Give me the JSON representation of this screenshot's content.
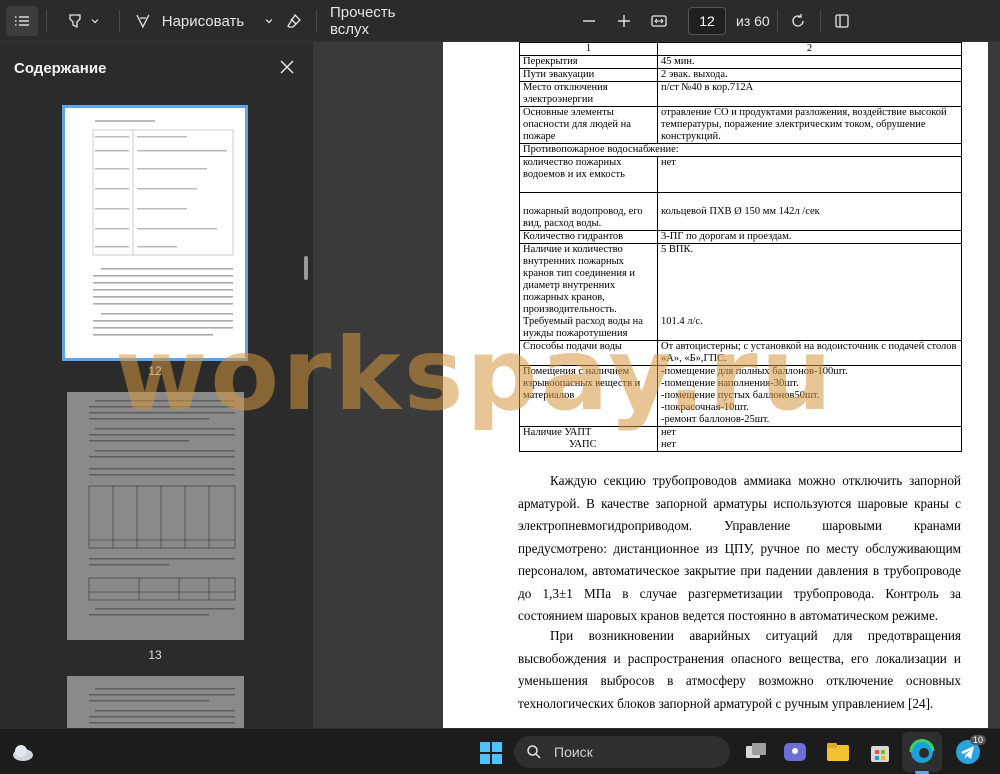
{
  "toolbar": {
    "draw_label": "Нарисовать",
    "read_aloud_label": "Прочесть вслух",
    "page_number": "12",
    "page_total": "из 60"
  },
  "sidebar": {
    "title": "Содержание",
    "thumbnails": [
      {
        "label": "12",
        "selected": true
      },
      {
        "label": "13",
        "selected": false
      }
    ]
  },
  "document": {
    "table": {
      "header": [
        "1",
        "2"
      ],
      "rows": [
        {
          "c1": "Перекрытия",
          "c2": "45 мин."
        },
        {
          "c1": "Пути эвакуации",
          "c2": "2 эвак. выхода."
        },
        {
          "c1": "Место отключения электроэнергии",
          "c2": "п/ст №40 в кор.712А"
        },
        {
          "c1": "Основные элементы опасности для людей на пожаре",
          "c2": "отравление СО и продуктами разложения, воздействие высокой температуры, поражение электрическим током, обрушение конструкций."
        },
        {
          "span": "Противопожарное водоснабжение:"
        },
        {
          "c1": "количество пожарных водоемов и их емкость",
          "c2": "нет"
        },
        {
          "c1": "пожарный водопровод, его вид, расход воды.",
          "c2": "кольцевой  ПХВ Ø 150 мм 142л /сек"
        },
        {
          "c1": "Количество гидрантов",
          "c2": "3-ПГ по дорогам и проездам."
        },
        {
          "c1": "Наличие и количество внутренних пожарных кранов тип соединения и диаметр внутренних пожарных кранов, производительность.",
          "c2": "5 ВПК."
        },
        {
          "c1": "Требуемый расход воды на нужды пожаротушения",
          "c2": "101.4 л/с."
        },
        {
          "c1": "Способы подачи воды",
          "c2": "От автоцистерны; с установкой на водоисточник с подачей столов «А», «Б»,ГПС."
        },
        {
          "c1": "Помещения с наличием взрывоопасных веществ и материалов",
          "c2_lines": [
            "-помещение для полных баллонов-100шт.",
            "-помещение наполнения-30шт.",
            "-помещение пустых баллонов50шт.",
            "-покрасочная-10шт.",
            "-ремонт баллонов-25шт."
          ]
        },
        {
          "c1_lines": [
            "Наличие УАПТ",
            "УАПС"
          ],
          "c2_lines": [
            "нет",
            "нет"
          ]
        }
      ]
    },
    "paragraphs": [
      "Каждую секцию трубопроводов аммиака можно отключить запорной арматурой. В качестве запорной арматуры используются шаровые краны с электропневмогидроприводом. Управление шаровыми кранами предусмотрено: дистанционное из ЦПУ, ручное по месту обслуживающим персоналом, автоматическое закрытие при падении давления в трубопроводе до 1,3±1 МПа в случае разгерметизации трубопровода. Контроль за состоянием шаровых кранов ведется постоянно в автоматическом режиме.",
      "При возникновении аварийных ситуаций для предотвращения высвобождения и распространения опасного вещества, его локализации и уменьшения выбросов в атмосферу возможно отключение основных технологических блоков запорной арматурой с ручным управлением [24]."
    ]
  },
  "watermark": "workspay.ru",
  "taskbar": {
    "search_label": "Поиск",
    "telegram_badge": "10"
  },
  "colors": {
    "accent": "#5aa6ef",
    "watermark": "#d6963c",
    "toolbar_bg": "#2b2b2b",
    "reader_bg": "#3a3a3a"
  }
}
